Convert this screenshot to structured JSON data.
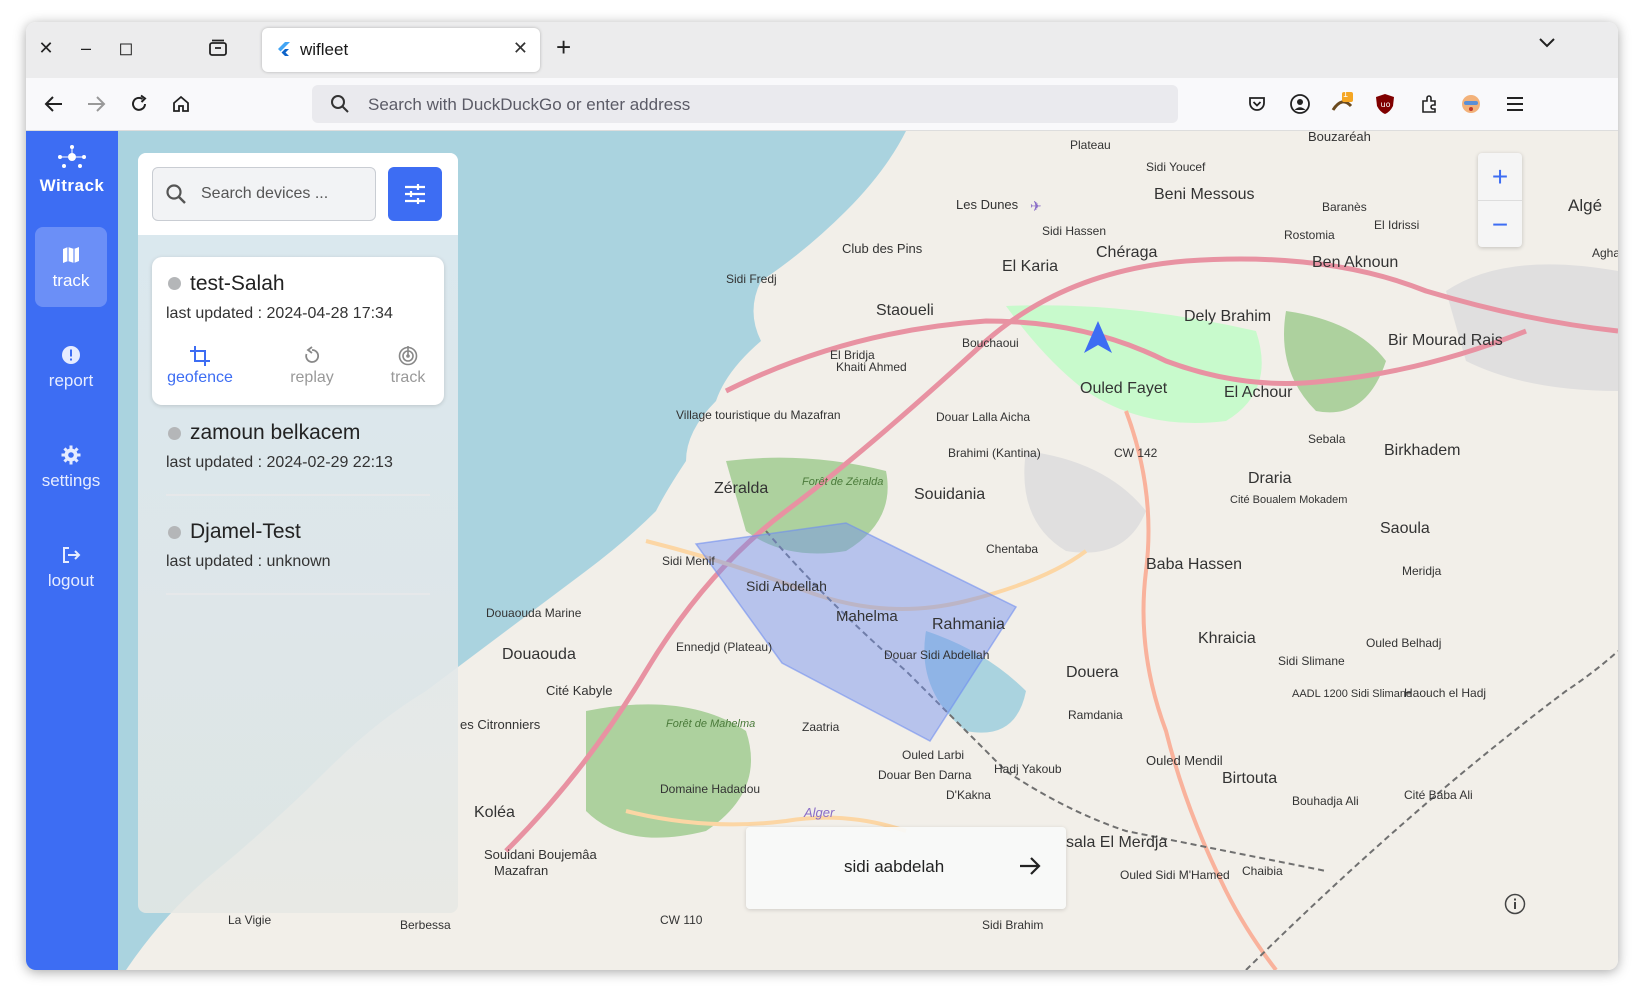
{
  "browser": {
    "tab_title": "wifleet",
    "address_placeholder": "Search with DuckDuckGo or enter address",
    "extension_badge": "1"
  },
  "sidebar": {
    "logo_text": "Witrack",
    "items": [
      {
        "label": "track",
        "icon": "map-icon",
        "active": true
      },
      {
        "label": "report",
        "icon": "alert-icon",
        "active": false
      },
      {
        "label": "settings",
        "icon": "gear-icon",
        "active": false
      },
      {
        "label": "logout",
        "icon": "logout-icon",
        "active": false
      }
    ]
  },
  "devices_panel": {
    "search_placeholder": "Search devices ...",
    "devices": [
      {
        "name": "test-Salah",
        "last_updated": "last updated : 2024-04-28 17:34",
        "actions": [
          {
            "label": "geofence",
            "icon": "crop-icon",
            "active": true
          },
          {
            "label": "replay",
            "icon": "replay-icon",
            "active": false
          },
          {
            "label": "track",
            "icon": "radar-icon",
            "active": false
          }
        ]
      },
      {
        "name": "zamoun belkacem",
        "last_updated": "last updated : 2024-02-29 22:13"
      },
      {
        "name": "Djamel-Test",
        "last_updated": "last updated : unknown"
      }
    ]
  },
  "map": {
    "zoom_in": "+",
    "zoom_out": "−",
    "geofence_destination": "sidi aabdelah",
    "labels": [
      "Plateau",
      "Bouzaréah",
      "Sidi Youcef",
      "Beni Messous",
      "Les Dunes",
      "Sidi Hassen",
      "Chéraga",
      "Baranès",
      "El Idrissi",
      "Rostomia",
      "Ben Aknoun",
      "Club des Pins",
      "Sidi Fredj",
      "El Karia",
      "Staoueli",
      "Dely Brahim",
      "Bir Mourad Rais",
      "Bouchaoui",
      "El Bridja",
      "Ouled Fayet",
      "El Achour",
      "Khaiti Ahmed",
      "Douar Lalla Aicha",
      "Sebala",
      "Birkhadem",
      "Village touristique du Mazafran",
      "Brahimi (Kantina)",
      "CW 142",
      "Zéralda",
      "Souidania",
      "Draria",
      "Cité Boualem Mokadem",
      "Saoula",
      "Chentaba",
      "Baba Hassen",
      "Meridja",
      "Sidi Menif",
      "Sidi Abdellah",
      "Mahelma",
      "Rahmania",
      "Khraicia",
      "Douaouda Marine",
      "Douaouda",
      "Ennedjd (Plateau)",
      "Douar Sidi Abdellah",
      "Douera",
      "Ouled Belhadj",
      "Sidi Slimane",
      "Cité Kabyle",
      "AADL 1200 Sidi Slimane",
      "Haouch el Hadj",
      "es Citronniers",
      "Zaatria",
      "Ramdania",
      "Ouled Larbi",
      "Hadj Yakoub",
      "Ouled Mendil",
      "Douar Ben Darna",
      "D'Kakna",
      "Birtouta",
      "Domaine Hadadou",
      "Koléa",
      "Bouhadja Ali",
      "Cité Baba Ali",
      "sala El Merdja",
      "Souidani Boujemâa",
      "Mazafran",
      "Chaibia",
      "Ouled Sidi M'Hamed",
      "CW 110",
      "La Vigie",
      "Berbessa",
      "Sidi Brahim",
      "Alger",
      "Forêt de Zéralda",
      "Forêt de Mahelma",
      "Algé",
      "Agha"
    ]
  },
  "colors": {
    "accent": "#3d6df3",
    "sea": "#aad3df",
    "land": "#f2efe9",
    "geofence": "#6f8df0"
  }
}
